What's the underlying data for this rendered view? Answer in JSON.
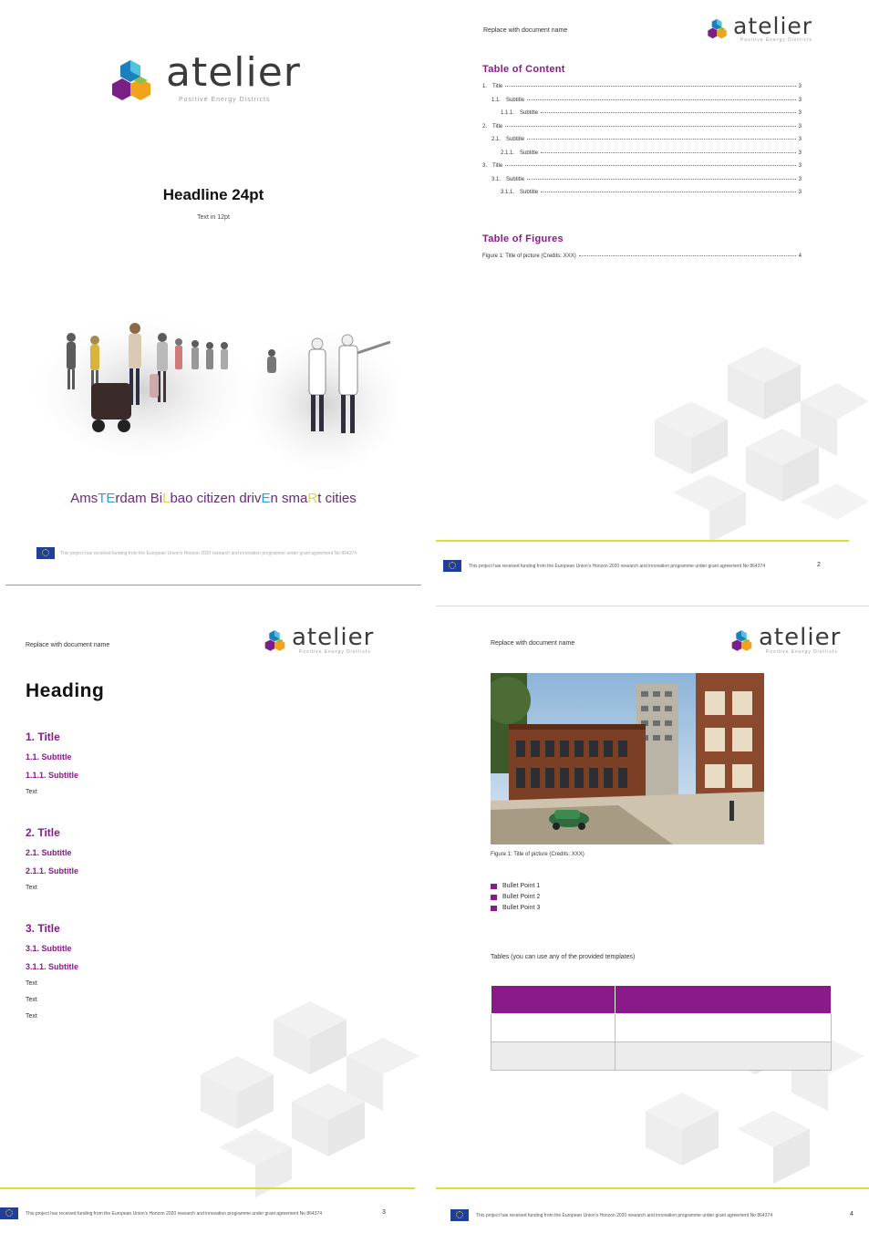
{
  "brand": {
    "logo_text": "atelier",
    "logo_subtitle": "Positive Energy Districts",
    "colors": {
      "purple": "#8a1a8a",
      "blue": "#2a8fc8",
      "yellow": "#d7dd3b",
      "green": "#8bc34a",
      "cyan": "#4fc3e0"
    }
  },
  "cover": {
    "headline": "Headline 24pt",
    "subline": "Text in 12pt",
    "image": "crowd-watercolor-illustration",
    "tagline": [
      {
        "t": "Ams",
        "c": "#6a2a7a"
      },
      {
        "t": "TE",
        "c": "#2a9fd8"
      },
      {
        "t": "rdam Bi",
        "c": "#6a2a7a"
      },
      {
        "t": "L",
        "c": "#d7dd3b"
      },
      {
        "t": "bao citizen driv",
        "c": "#6a2a7a"
      },
      {
        "t": "E",
        "c": "#2a9fd8"
      },
      {
        "t": "n sma",
        "c": "#6a2a7a"
      },
      {
        "t": "R",
        "c": "#d7dd3b"
      },
      {
        "t": "t cities",
        "c": "#6a2a7a"
      }
    ]
  },
  "footer": {
    "funding_text": "This project has received funding from the European Union's Horizon 2020 research and innovation programme under grant agreement No 864374",
    "pages": {
      "p2": "2",
      "p3": "3",
      "p4": "4"
    }
  },
  "doc_header": {
    "replace_note": "Replace with document name"
  },
  "toc": {
    "title": "Table of Content",
    "entries": [
      {
        "num": "1.",
        "label": "Title",
        "page": "3"
      },
      {
        "num": "1.1.",
        "label": "Subtitle",
        "page": "3"
      },
      {
        "num": "1.1.1.",
        "label": "Subtitle",
        "page": "3"
      },
      {
        "num": "2.",
        "label": "Title",
        "page": "3"
      },
      {
        "num": "2.1.",
        "label": "Subtitle",
        "page": "3"
      },
      {
        "num": "2.1.1.",
        "label": "Subtitle",
        "page": "3"
      },
      {
        "num": "3.",
        "label": "Title",
        "page": "3"
      },
      {
        "num": "3.1.",
        "label": "Subtitle",
        "page": "3"
      },
      {
        "num": "3.1.1.",
        "label": "Subtitle",
        "page": "3"
      }
    ]
  },
  "tof": {
    "title": "Table of Figures",
    "entries": [
      {
        "label": "Figure 1: Title of picture (Credits: XXX)",
        "page": "4"
      }
    ]
  },
  "page3": {
    "heading": "Heading",
    "sections": [
      {
        "title": "1. Title",
        "sub": "1.1.  Subtitle",
        "subsub": "1.1.1. Subtitle",
        "texts": [
          "Text"
        ]
      },
      {
        "title": "2. Title",
        "sub": "2.1.  Subtitle",
        "subsub": "2.1.1. Subtitle",
        "texts": [
          "Text"
        ]
      },
      {
        "title": "3. Title",
        "sub": "3.1.  Subtitle",
        "subsub": "3.1.1. Subtitle",
        "texts": [
          "Text",
          "Text",
          "Text"
        ]
      }
    ]
  },
  "page4": {
    "image": "urban-building-rendering",
    "caption": "Figure 1: Title of picture (Credits: XXX)",
    "bullets": [
      "Bullet Point 1",
      "Bullet Point 2",
      "Bullet Point 3"
    ],
    "table_note": "Tables (you can use any of the provided templates)"
  }
}
